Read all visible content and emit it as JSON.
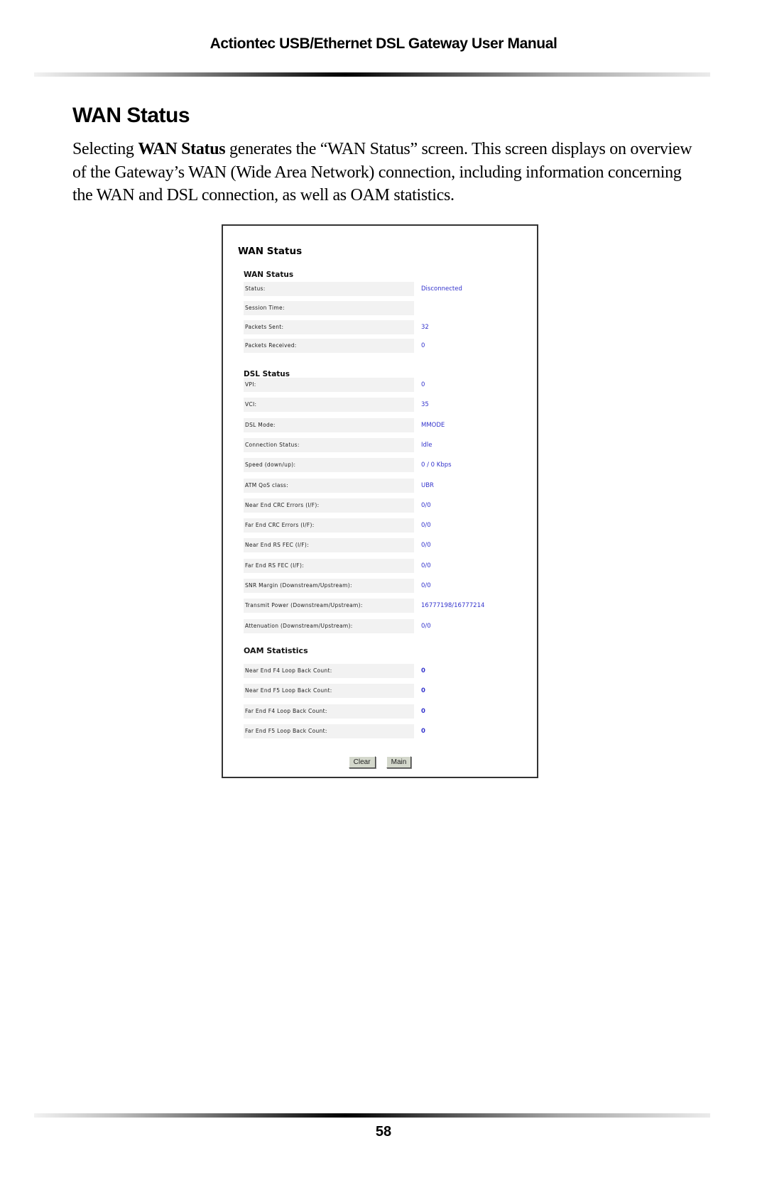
{
  "header": {
    "title": "Actiontec USB/Ethernet DSL Gateway User Manual"
  },
  "section": {
    "title": "WAN Status",
    "intro_prefix": "Selecting ",
    "intro_bold": "WAN Status",
    "intro_suffix": " generates the “WAN Status” screen. This screen displays on overview of the Gateway’s WAN (Wide Area Network) connection, including information concerning the WAN and DSL connection, as well as OAM statistics."
  },
  "screenshot": {
    "title": "WAN Status",
    "wan_status": {
      "heading": "WAN Status",
      "rows": [
        {
          "label": "Status:",
          "value": "Disconnected"
        },
        {
          "label": "Session Time:",
          "value": ""
        },
        {
          "label": "Packets Sent:",
          "value": "32"
        },
        {
          "label": "Packets Received:",
          "value": "0"
        }
      ]
    },
    "dsl_status": {
      "heading": "DSL Status",
      "rows": [
        {
          "label": "VPI:",
          "value": "0"
        },
        {
          "label": "VCI:",
          "value": "35"
        },
        {
          "label": "DSL Mode:",
          "value": "MMODE"
        },
        {
          "label": "Connection Status:",
          "value": "Idle"
        },
        {
          "label": "Speed (down/up):",
          "value": "0 / 0 Kbps"
        },
        {
          "label": "ATM QoS class:",
          "value": "UBR"
        },
        {
          "label": "Near End CRC Errors (I/F):",
          "value": "0/0"
        },
        {
          "label": "Far End CRC Errors (I/F):",
          "value": "0/0"
        },
        {
          "label": "Near End RS FEC (I/F):",
          "value": "0/0"
        },
        {
          "label": "Far End RS FEC (I/F):",
          "value": "0/0"
        },
        {
          "label": "SNR Margin (Downstream/Upstream):",
          "value": "0/0"
        },
        {
          "label": "Transmit Power (Downstream/Upstream):",
          "value": "16777198/16777214"
        },
        {
          "label": "Attenuation (Downstream/Upstream):",
          "value": "0/0"
        }
      ]
    },
    "oam_statistics": {
      "heading": "OAM Statistics",
      "rows": [
        {
          "label": "Near End F4 Loop Back Count:",
          "value": "0"
        },
        {
          "label": "Near End F5 Loop Back Count:",
          "value": "0"
        },
        {
          "label": "Far End F4 Loop Back Count:",
          "value": "0"
        },
        {
          "label": "Far End F5 Loop Back Count:",
          "value": "0"
        }
      ]
    },
    "buttons": {
      "clear": "Clear",
      "main": "Main"
    },
    "value_color": "#3333cc"
  },
  "footer": {
    "page_number": "58"
  }
}
